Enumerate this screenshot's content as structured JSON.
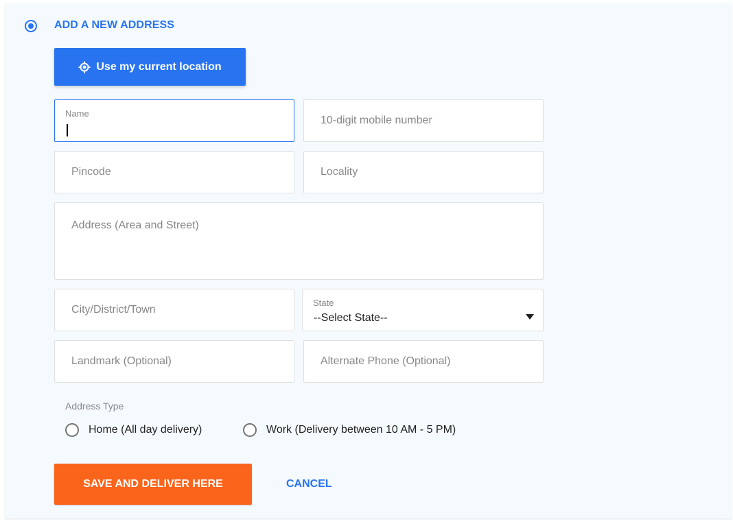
{
  "section": {
    "title": "ADD A NEW ADDRESS"
  },
  "location_button": {
    "label": "Use my current location",
    "icon": "crosshair-icon"
  },
  "fields": {
    "name": {
      "label": "Name",
      "value": ""
    },
    "mobile": {
      "placeholder": "10-digit mobile number"
    },
    "pincode": {
      "placeholder": "Pincode"
    },
    "locality": {
      "placeholder": "Locality"
    },
    "address": {
      "placeholder": "Address (Area and Street)"
    },
    "city": {
      "placeholder": "City/District/Town"
    },
    "state": {
      "label": "State",
      "selected": "--Select State--"
    },
    "landmark": {
      "placeholder": "Landmark (Optional)"
    },
    "alt_phone": {
      "placeholder": "Alternate Phone (Optional)"
    }
  },
  "address_type": {
    "label": "Address Type",
    "options": [
      {
        "label": "Home (All day delivery)",
        "selected": false
      },
      {
        "label": "Work (Delivery between 10 AM - 5 PM)",
        "selected": false
      }
    ]
  },
  "actions": {
    "save_label": "SAVE AND DELIVER HERE",
    "cancel_label": "CANCEL"
  },
  "colors": {
    "accent": "#2874f0",
    "save": "#fb641b",
    "panel_bg": "#f5faff"
  }
}
